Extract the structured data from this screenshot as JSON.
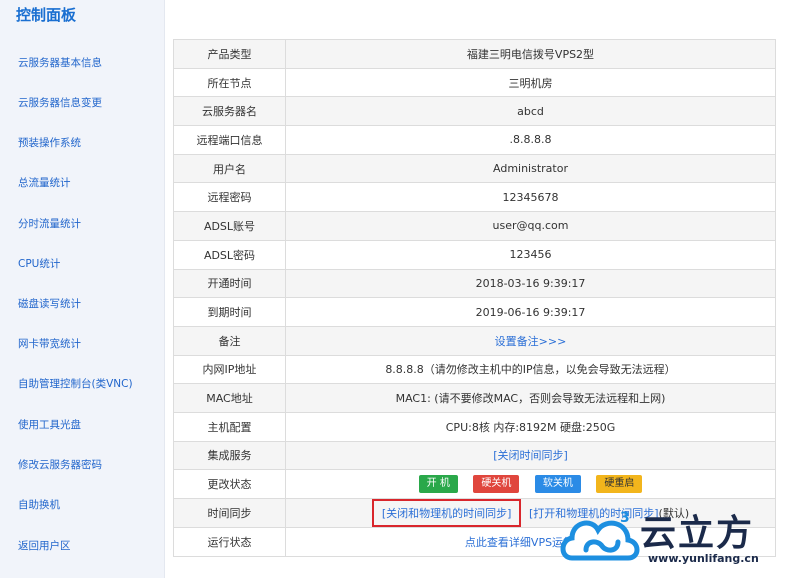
{
  "sidebar": {
    "title": "控制面板",
    "items": [
      {
        "label": "云服务器基本信息"
      },
      {
        "label": "云服务器信息变更"
      },
      {
        "label": "预装操作系统"
      },
      {
        "label": "总流量统计"
      },
      {
        "label": "分时流量统计"
      },
      {
        "label": "CPU统计"
      },
      {
        "label": "磁盘读写统计"
      },
      {
        "label": "网卡带宽统计"
      },
      {
        "label": "自助管理控制台(类VNC)"
      },
      {
        "label": "使用工具光盘"
      },
      {
        "label": "修改云服务器密码"
      },
      {
        "label": "自助换机"
      },
      {
        "label": "返回用户区"
      }
    ]
  },
  "info": {
    "product_type": {
      "label": "产品类型",
      "value": "福建三明电信拨号VPS2型"
    },
    "node": {
      "label": "所在节点",
      "value": "三明机房"
    },
    "server_name": {
      "label": "云服务器名",
      "value": "abcd"
    },
    "remote_port": {
      "label": "远程端口信息",
      "value": ".8.8.8.8"
    },
    "username": {
      "label": "用户名",
      "value": "Administrator"
    },
    "remote_password": {
      "label": "远程密码",
      "value": "12345678"
    },
    "adsl_account": {
      "label": "ADSL账号",
      "value": "user@qq.com"
    },
    "adsl_password": {
      "label": "ADSL密码",
      "value": "123456"
    },
    "open_time": {
      "label": "开通时间",
      "value": "2018-03-16 9:39:17"
    },
    "expire_time": {
      "label": "到期时间",
      "value": "2019-06-16 9:39:17"
    },
    "remark": {
      "label": "备注",
      "link": "设置备注>>>"
    },
    "lan_ip": {
      "label": "内网IP地址",
      "value": "8.8.8.8（请勿修改主机中的IP信息，以免会导致无法远程）"
    },
    "mac": {
      "label": "MAC地址",
      "value": "MAC1: (请不要修改MAC，否则会导致无法远程和上网)"
    },
    "host_config": {
      "label": "主机配置",
      "value": "CPU:8核 内存:8192M 硬盘:250G"
    },
    "integration": {
      "label": "集成服务",
      "link": "[关闭时间同步]"
    },
    "change_state": {
      "label": "更改状态",
      "buttons": {
        "on": "开 机",
        "hard_off": "硬关机",
        "soft_off": "软关机",
        "hard_restart": "硬重启"
      }
    },
    "time_sync": {
      "label": "时间同步",
      "close_link": "[关闭和物理机的时间同步]",
      "open_link": "[打开和物理机的时间同步]",
      "open_suffix": "(默认)"
    },
    "run_state": {
      "label": "运行状态",
      "link": "点此查看详细VPS运行信息"
    }
  },
  "watermark": {
    "brand": "云立方",
    "url": "www.yunlifang.cn"
  },
  "colors": {
    "accent": "#2b6fd6",
    "highlight": "#d9262c"
  }
}
